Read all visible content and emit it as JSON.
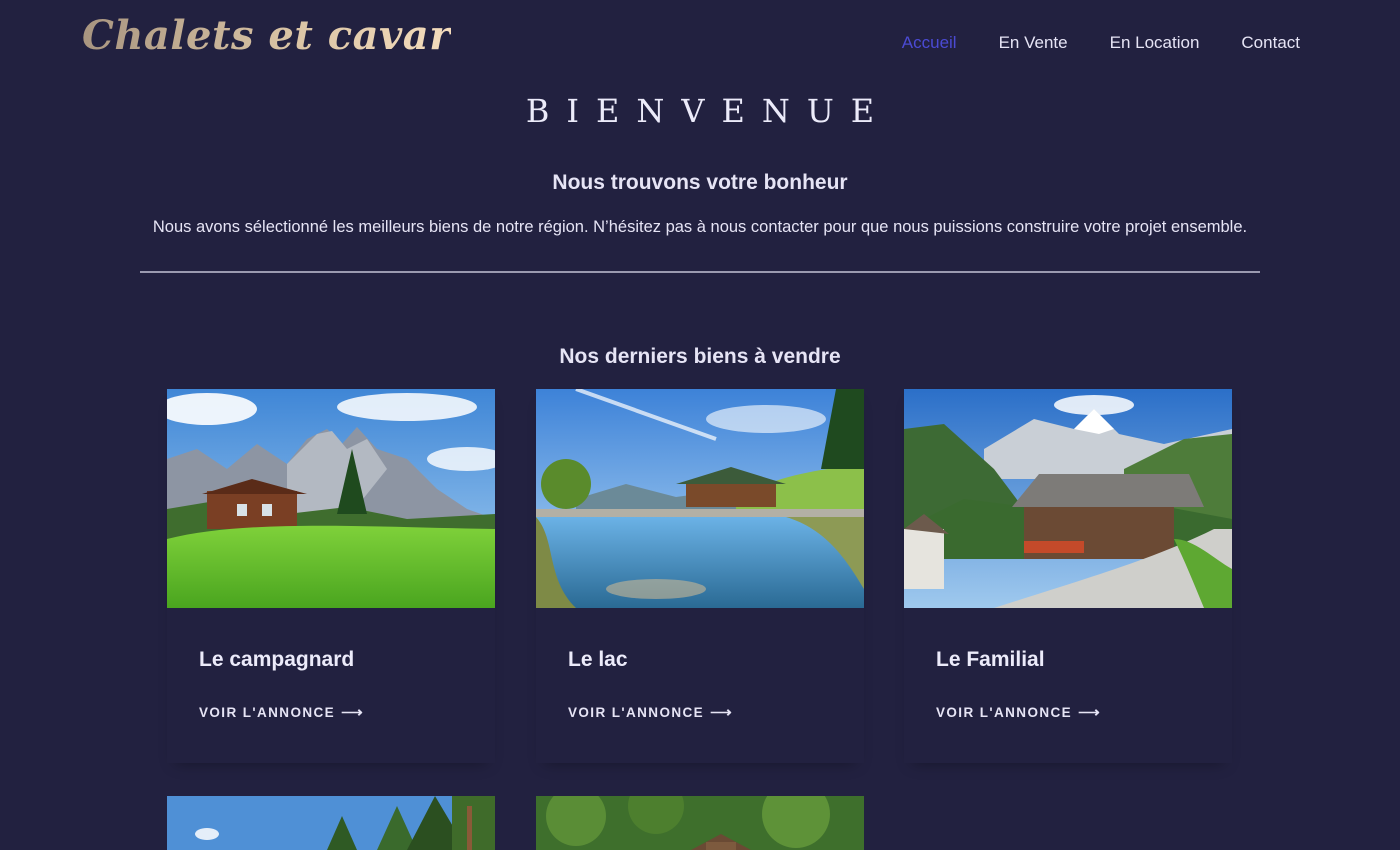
{
  "header": {
    "logo_text": "Chalets et cavar",
    "nav": [
      {
        "label": "Accueil",
        "active": true
      },
      {
        "label": "En Vente",
        "active": false
      },
      {
        "label": "En Location",
        "active": false
      },
      {
        "label": "Contact",
        "active": false
      }
    ]
  },
  "welcome": {
    "title": "BIENVENUE",
    "subtitle": "Nous trouvons votre bonheur",
    "text": "Nous avons sélectionné les meilleurs biens de notre région. N’hésitez pas à nous contacter pour que nous puissions construire votre projet ensemble."
  },
  "listings": {
    "title": "Nos derniers biens à vendre",
    "link_label": "VOIR L'ANNONCE",
    "cards": [
      {
        "title": "Le campagnard",
        "image": "chalet-meadow-mountains-photo"
      },
      {
        "title": "Le lac",
        "image": "chalet-lake-photo"
      },
      {
        "title": "Le Familial",
        "image": "chalet-alpine-road-photo"
      },
      {
        "title": "",
        "image": "forest-sky-photo"
      },
      {
        "title": "",
        "image": "forest-cabin-photo"
      }
    ]
  },
  "icons": {
    "arrow": "arrow-right-icon"
  },
  "colors": {
    "background": "#222140",
    "text": "#e6e4f5",
    "nav_active": "#4b4ad3",
    "divider": "#9b9ab0",
    "logo_gradient_start": "#a89580",
    "logo_gradient_end": "#f4dcbc"
  }
}
